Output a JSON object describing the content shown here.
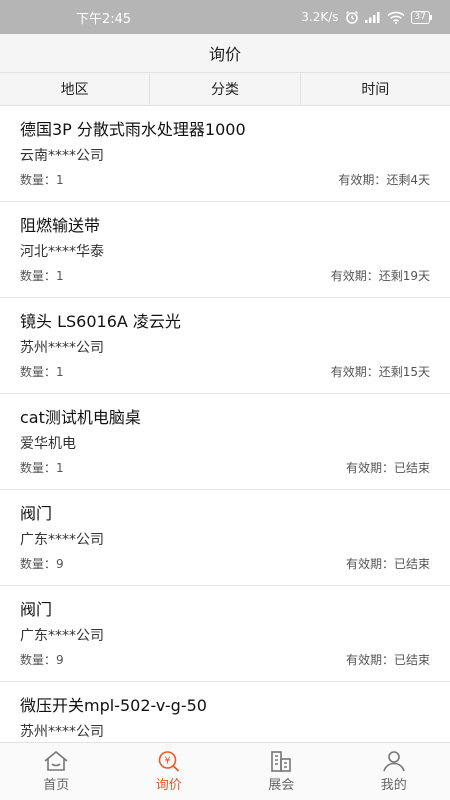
{
  "status_bar": {
    "time": "下午2:45",
    "network_speed": "3.2K/s",
    "battery": "37",
    "icons": [
      "alarm-icon",
      "signal-icon",
      "wifi-icon",
      "battery-icon"
    ]
  },
  "header": {
    "title": "询价"
  },
  "filters": [
    {
      "label": "地区"
    },
    {
      "label": "分类"
    },
    {
      "label": "时间"
    }
  ],
  "items": [
    {
      "title": "德国3P 分散式雨水处理器1000",
      "company": "云南****公司",
      "quantity": "数量：1",
      "validity": "有效期：还剩4天"
    },
    {
      "title": "阻燃输送带",
      "company": "河北****华泰",
      "quantity": "数量：1",
      "validity": "有效期：还剩19天"
    },
    {
      "title": "镜头 LS6016A 凌云光",
      "company": "苏州****公司",
      "quantity": "数量：1",
      "validity": "有效期：还剩15天"
    },
    {
      "title": "cat测试机电脑桌",
      "company": "爱华机电",
      "quantity": "数量：1",
      "validity": "有效期：已结束"
    },
    {
      "title": "阀门",
      "company": "广东****公司",
      "quantity": "数量：9",
      "validity": "有效期：已结束"
    },
    {
      "title": "阀门",
      "company": "广东****公司",
      "quantity": "数量：9",
      "validity": "有效期：已结束"
    },
    {
      "title": "微压开关mpl-502-v-g-50",
      "company": "苏州****公司",
      "quantity": "",
      "validity": ""
    }
  ],
  "tabbar": {
    "active_color": "#e8562a",
    "tabs": [
      {
        "label": "首页",
        "icon": "home-icon"
      },
      {
        "label": "询价",
        "icon": "inquiry-icon"
      },
      {
        "label": "展会",
        "icon": "exhibition-icon"
      },
      {
        "label": "我的",
        "icon": "profile-icon"
      }
    ]
  }
}
